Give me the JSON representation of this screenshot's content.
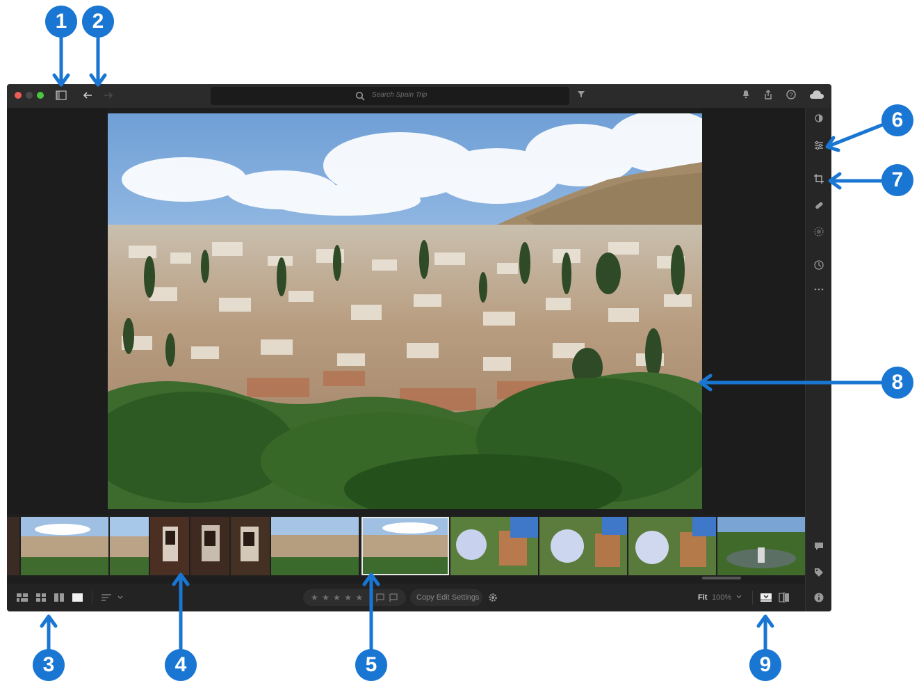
{
  "search": {
    "placeholder": "Search Spain Trip"
  },
  "toolbar": {
    "stars": "★ ★ ★ ★ ★",
    "copy_edit": "Copy Edit Settings",
    "fit": "Fit",
    "zoom": "100%"
  },
  "callouts": [
    "1",
    "2",
    "3",
    "4",
    "5",
    "6",
    "7",
    "8",
    "9"
  ],
  "colors": {
    "accent": "#1976d2",
    "window": "#1e1e1e",
    "titlebar": "#2b2b2b"
  }
}
